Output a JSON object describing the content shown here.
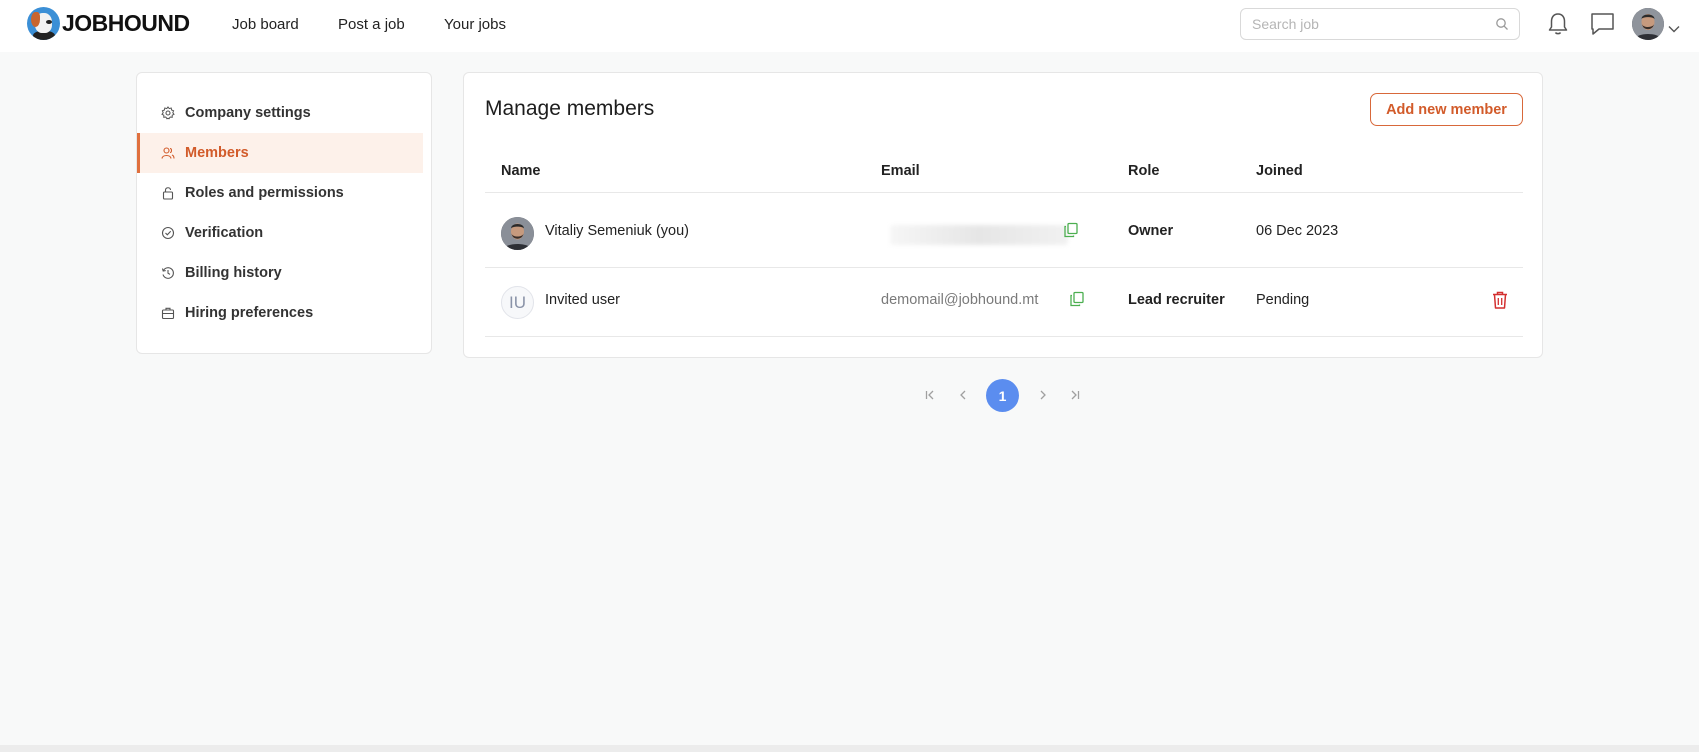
{
  "header": {
    "logo_text": "JOBHOUND",
    "nav": [
      "Job board",
      "Post a job",
      "Your jobs"
    ],
    "search_placeholder": "Search job"
  },
  "sidebar": {
    "items": [
      {
        "label": "Company settings",
        "icon": "gear-icon",
        "active": false
      },
      {
        "label": "Members",
        "icon": "members-icon",
        "active": true
      },
      {
        "label": "Roles and permissions",
        "icon": "lock-icon",
        "active": false
      },
      {
        "label": "Verification",
        "icon": "check-circle-icon",
        "active": false
      },
      {
        "label": "Billing history",
        "icon": "history-icon",
        "active": false
      },
      {
        "label": "Hiring preferences",
        "icon": "briefcase-icon",
        "active": false
      }
    ]
  },
  "main": {
    "title": "Manage members",
    "add_button": "Add new member",
    "columns": [
      "Name",
      "Email",
      "Role",
      "Joined"
    ],
    "rows": [
      {
        "name": "Vitaliy Semeniuk (you)",
        "email": "",
        "role": "Owner",
        "joined": "06 Dec 2023",
        "avatar": "photo"
      },
      {
        "name": "Invited user",
        "email": "demomail@jobhound.mt",
        "role": "Lead recruiter",
        "joined": "Pending",
        "avatar": "IU"
      }
    ]
  },
  "pagination": {
    "current": "1"
  },
  "colors": {
    "accent": "#d25b2a",
    "active_bg": "#fdf1ea",
    "page_current": "#5b8def",
    "copy_icon": "#4caf50",
    "trash_icon": "#d32f2f"
  }
}
